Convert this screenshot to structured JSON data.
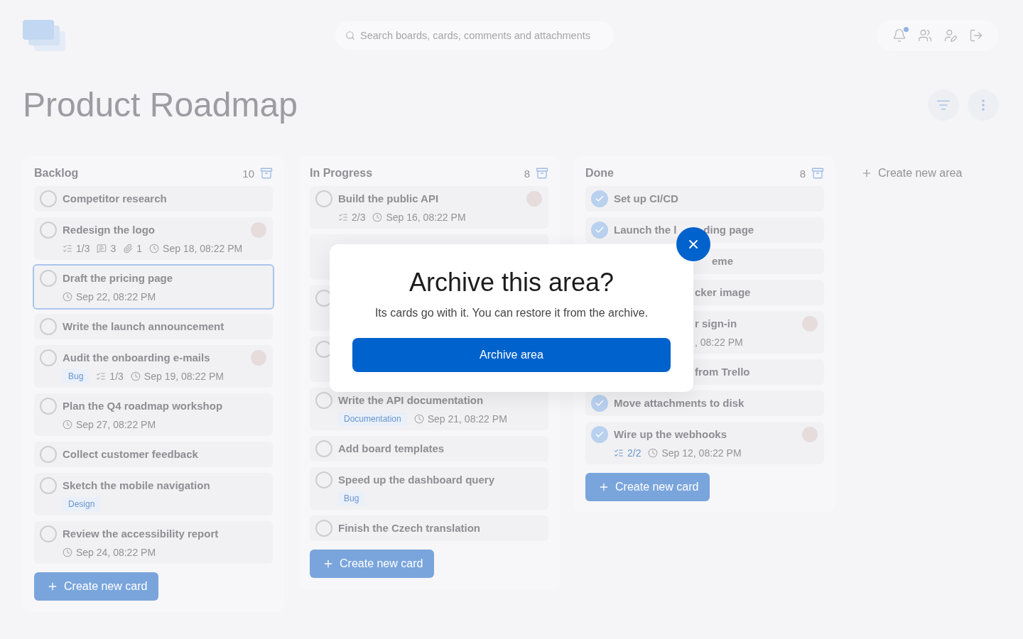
{
  "header": {
    "search": {
      "placeholder": "Search boards, cards, comments and attachments"
    },
    "notifications_unread": true
  },
  "board": {
    "title": "Product Roadmap"
  },
  "columns": [
    {
      "title": "Backlog",
      "count": "10",
      "add_label": "Create new card",
      "cards": [
        {
          "kind": "full",
          "title": "Competitor research",
          "done": false,
          "selected": false
        },
        {
          "kind": "full",
          "title": "Redesign the logo",
          "done": false,
          "selected": false,
          "avatar": true,
          "meta": [
            {
              "kind": "checklist",
              "text": "1/3",
              "complete": false
            },
            {
              "kind": "comments",
              "text": "3"
            },
            {
              "kind": "attachments",
              "text": "1"
            },
            {
              "kind": "due",
              "text": "Sep 18, 08:22 PM"
            }
          ]
        },
        {
          "kind": "full",
          "title": "Draft the pricing page",
          "done": false,
          "selected": true,
          "meta": [
            {
              "kind": "due",
              "text": "Sep 22, 08:22 PM"
            }
          ]
        },
        {
          "kind": "full",
          "title": "Write the launch announcement",
          "done": false,
          "selected": false
        },
        {
          "kind": "full",
          "title": "Audit the onboarding e-mails",
          "done": false,
          "selected": false,
          "avatar": true,
          "tags": [
            "Bug"
          ],
          "meta": [
            {
              "kind": "checklist",
              "text": "1/3",
              "complete": false
            },
            {
              "kind": "due",
              "text": "Sep 19, 08:22 PM"
            }
          ]
        },
        {
          "kind": "full",
          "title": "Plan the Q4 roadmap workshop",
          "done": false,
          "selected": false,
          "meta": [
            {
              "kind": "due",
              "text": "Sep 27, 08:22 PM"
            }
          ]
        },
        {
          "kind": "full",
          "title": "Collect customer feedback",
          "done": false,
          "selected": false
        },
        {
          "kind": "full",
          "title": "Sketch the mobile navigation",
          "done": false,
          "selected": false,
          "tags": [
            "Design"
          ]
        },
        {
          "kind": "full",
          "title": "Review the accessibility report",
          "done": false,
          "selected": false,
          "meta": [
            {
              "kind": "due",
              "text": "Sep 24, 08:22 PM"
            }
          ]
        }
      ]
    },
    {
      "title": "In Progress",
      "count": "8",
      "add_label": "Create new card",
      "cards": [
        {
          "kind": "full",
          "title": "Build the public API",
          "done": false,
          "selected": false,
          "avatar": true,
          "meta": [
            {
              "kind": "checklist",
              "text": "2/3",
              "complete": false
            },
            {
              "kind": "due",
              "text": "Sep 16, 08:22 PM"
            }
          ]
        },
        {
          "kind": "covered",
          "selected": false
        },
        {
          "kind": "covered",
          "done": false,
          "selected": false
        },
        {
          "kind": "covered",
          "done": false,
          "selected": false
        },
        {
          "kind": "full",
          "title": "Write the API documentation",
          "done": false,
          "selected": false,
          "tags": [
            "Documentation"
          ],
          "meta": [
            {
              "kind": "due",
              "text": "Sep 21, 08:22 PM"
            }
          ]
        },
        {
          "kind": "full",
          "title": "Add board templates",
          "done": false,
          "selected": false
        },
        {
          "kind": "full",
          "title": "Speed up the dashboard query",
          "done": false,
          "selected": false,
          "tags": [
            "Bug"
          ]
        },
        {
          "kind": "full",
          "title": "Finish the Czech translation",
          "done": false,
          "selected": false
        }
      ]
    },
    {
      "title": "Done",
      "count": "8",
      "add_label": "Create new card",
      "cards": [
        {
          "kind": "full",
          "title": "Set up CI/CD",
          "done": true,
          "selected": false
        },
        {
          "kind": "split",
          "title_parts": [
            "Launch the l",
            "ding page"
          ],
          "done": true,
          "selected": false
        },
        {
          "kind": "cut",
          "title": "eme",
          "selected": false
        },
        {
          "kind": "cut",
          "title": "cker image",
          "selected": false
        },
        {
          "kind": "cut",
          "title": "r sign-in",
          "avatar": true,
          "meta_text": ", 08:22 PM",
          "selected": false
        },
        {
          "kind": "cut",
          "title": "from Trello",
          "selected": false
        },
        {
          "kind": "full",
          "title": "Move attachments to disk",
          "done": true,
          "selected": false
        },
        {
          "kind": "full",
          "title": "Wire up the webhooks",
          "done": true,
          "selected": false,
          "avatar": true,
          "meta": [
            {
              "kind": "checklist",
              "text": "2/2",
              "complete": true
            },
            {
              "kind": "due",
              "text": "Sep 12, 08:22 PM"
            }
          ]
        }
      ]
    }
  ],
  "new_area": {
    "label": "Create new area"
  },
  "dialog": {
    "title": "Archive this area?",
    "message": "Its cards go with it. You can restore it from the archive.",
    "confirm": "Archive area"
  }
}
